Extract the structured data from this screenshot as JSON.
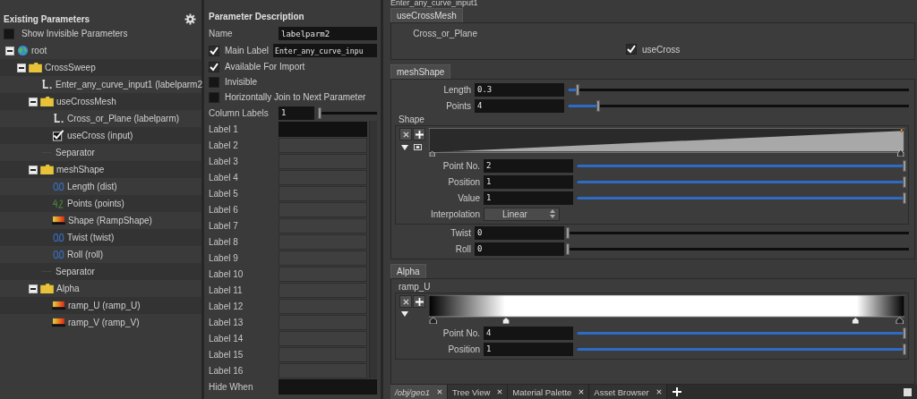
{
  "tree": {
    "title": "Existing Parameters",
    "show_invisible": {
      "label": "Show Invisible Parameters",
      "checked": false
    },
    "nodes": [
      {
        "kind": "root",
        "label": "root",
        "expanded": true,
        "children": [
          {
            "kind": "folder",
            "label": "CrossSweep",
            "expanded": true,
            "children": [
              {
                "kind": "label",
                "label": "Enter_any_curve_input1 (labelparm2"
              },
              {
                "kind": "folder",
                "label": "useCrossMesh",
                "expanded": true,
                "children": [
                  {
                    "kind": "label",
                    "label": "Cross_or_Plane (labelparm)"
                  },
                  {
                    "kind": "toggle",
                    "label": "useCross (input)"
                  }
                ]
              },
              {
                "kind": "separator",
                "label": "Separator"
              },
              {
                "kind": "folder",
                "label": "meshShape",
                "expanded": true,
                "children": [
                  {
                    "kind": "float",
                    "label": "Length (dist)"
                  },
                  {
                    "kind": "int",
                    "label": "Points (points)"
                  },
                  {
                    "kind": "ramp",
                    "label": "Shape (RampShape)"
                  },
                  {
                    "kind": "float",
                    "label": "Twist (twist)"
                  },
                  {
                    "kind": "float",
                    "label": "Roll (roll)"
                  }
                ]
              },
              {
                "kind": "separator",
                "label": "Separator"
              },
              {
                "kind": "folder",
                "label": "Alpha",
                "expanded": true,
                "children": [
                  {
                    "kind": "ramp",
                    "label": "ramp_U (ramp_U)"
                  },
                  {
                    "kind": "ramp",
                    "label": "ramp_V (ramp_V)"
                  }
                ]
              }
            ]
          }
        ]
      }
    ]
  },
  "description": {
    "title": "Parameter Description",
    "name": {
      "label": "Name",
      "value": "labelparm2"
    },
    "main_label": {
      "label": "Main Label",
      "checked": true,
      "value": "Enter_any_curve_inpu"
    },
    "options": [
      {
        "label": "Available For Import",
        "checked": true
      },
      {
        "label": "Invisible",
        "checked": false
      },
      {
        "label": "Horizontally Join to Next Parameter",
        "checked": false
      }
    ],
    "column_labels": {
      "label": "Column Labels",
      "value": "1",
      "level": 0
    },
    "labels": [
      {
        "label": "Label 1",
        "disabled": false
      },
      {
        "label": "Label 2",
        "disabled": true
      },
      {
        "label": "Label 3",
        "disabled": true
      },
      {
        "label": "Label 4",
        "disabled": true
      },
      {
        "label": "Label 5",
        "disabled": true
      },
      {
        "label": "Label 6",
        "disabled": true
      },
      {
        "label": "Label 7",
        "disabled": true
      },
      {
        "label": "Label 8",
        "disabled": true
      },
      {
        "label": "Label 9",
        "disabled": true
      },
      {
        "label": "Label 10",
        "disabled": true
      },
      {
        "label": "Label 11",
        "disabled": true
      },
      {
        "label": "Label 12",
        "disabled": true
      },
      {
        "label": "Label 13",
        "disabled": true
      },
      {
        "label": "Label 14",
        "disabled": true
      },
      {
        "label": "Label 15",
        "disabled": true
      },
      {
        "label": "Label 16",
        "disabled": true
      }
    ],
    "hide_when": {
      "label": "Hide When"
    }
  },
  "preview": {
    "header": "Enter_any_curve_input1",
    "folders": [
      {
        "tab": "useCrossMesh",
        "items": [
          {
            "kind": "label",
            "text": "Cross_or_Plane"
          },
          {
            "kind": "toggle",
            "label": "useCross",
            "checked": true
          }
        ]
      },
      {
        "tab": "meshShape",
        "items": [
          {
            "kind": "slider",
            "label": "Length",
            "value": "0.3",
            "level": 0.03
          },
          {
            "kind": "slider",
            "label": "Points",
            "value": "4",
            "level": 0.09
          },
          {
            "kind": "curve_ramp",
            "label": "Shape",
            "parms": [
              {
                "label": "Point No.",
                "value": "2",
                "level": 1
              },
              {
                "label": "Position",
                "value": "1",
                "level": 1
              },
              {
                "label": "Value",
                "value": "1",
                "level": 1
              }
            ],
            "interpolation": {
              "label": "Interpolation",
              "value": "Linear"
            }
          },
          {
            "kind": "slider",
            "label": "Twist",
            "value": "0",
            "level": 0
          },
          {
            "kind": "slider",
            "label": "Roll",
            "value": "0",
            "level": 0
          }
        ]
      },
      {
        "tab": "Alpha",
        "items": [
          {
            "kind": "gradient_ramp",
            "label": "ramp_U",
            "parms": [
              {
                "label": "Point No.",
                "value": "4",
                "level": 1
              },
              {
                "label": "Position",
                "value": "1",
                "level": 1
              }
            ]
          }
        ]
      }
    ],
    "bottom_tabs": [
      {
        "label": "/obj/geo1",
        "selected": true
      },
      {
        "label": "Tree View",
        "selected": false
      },
      {
        "label": "Material Palette",
        "selected": false
      },
      {
        "label": "Asset Browser",
        "selected": false
      }
    ]
  }
}
